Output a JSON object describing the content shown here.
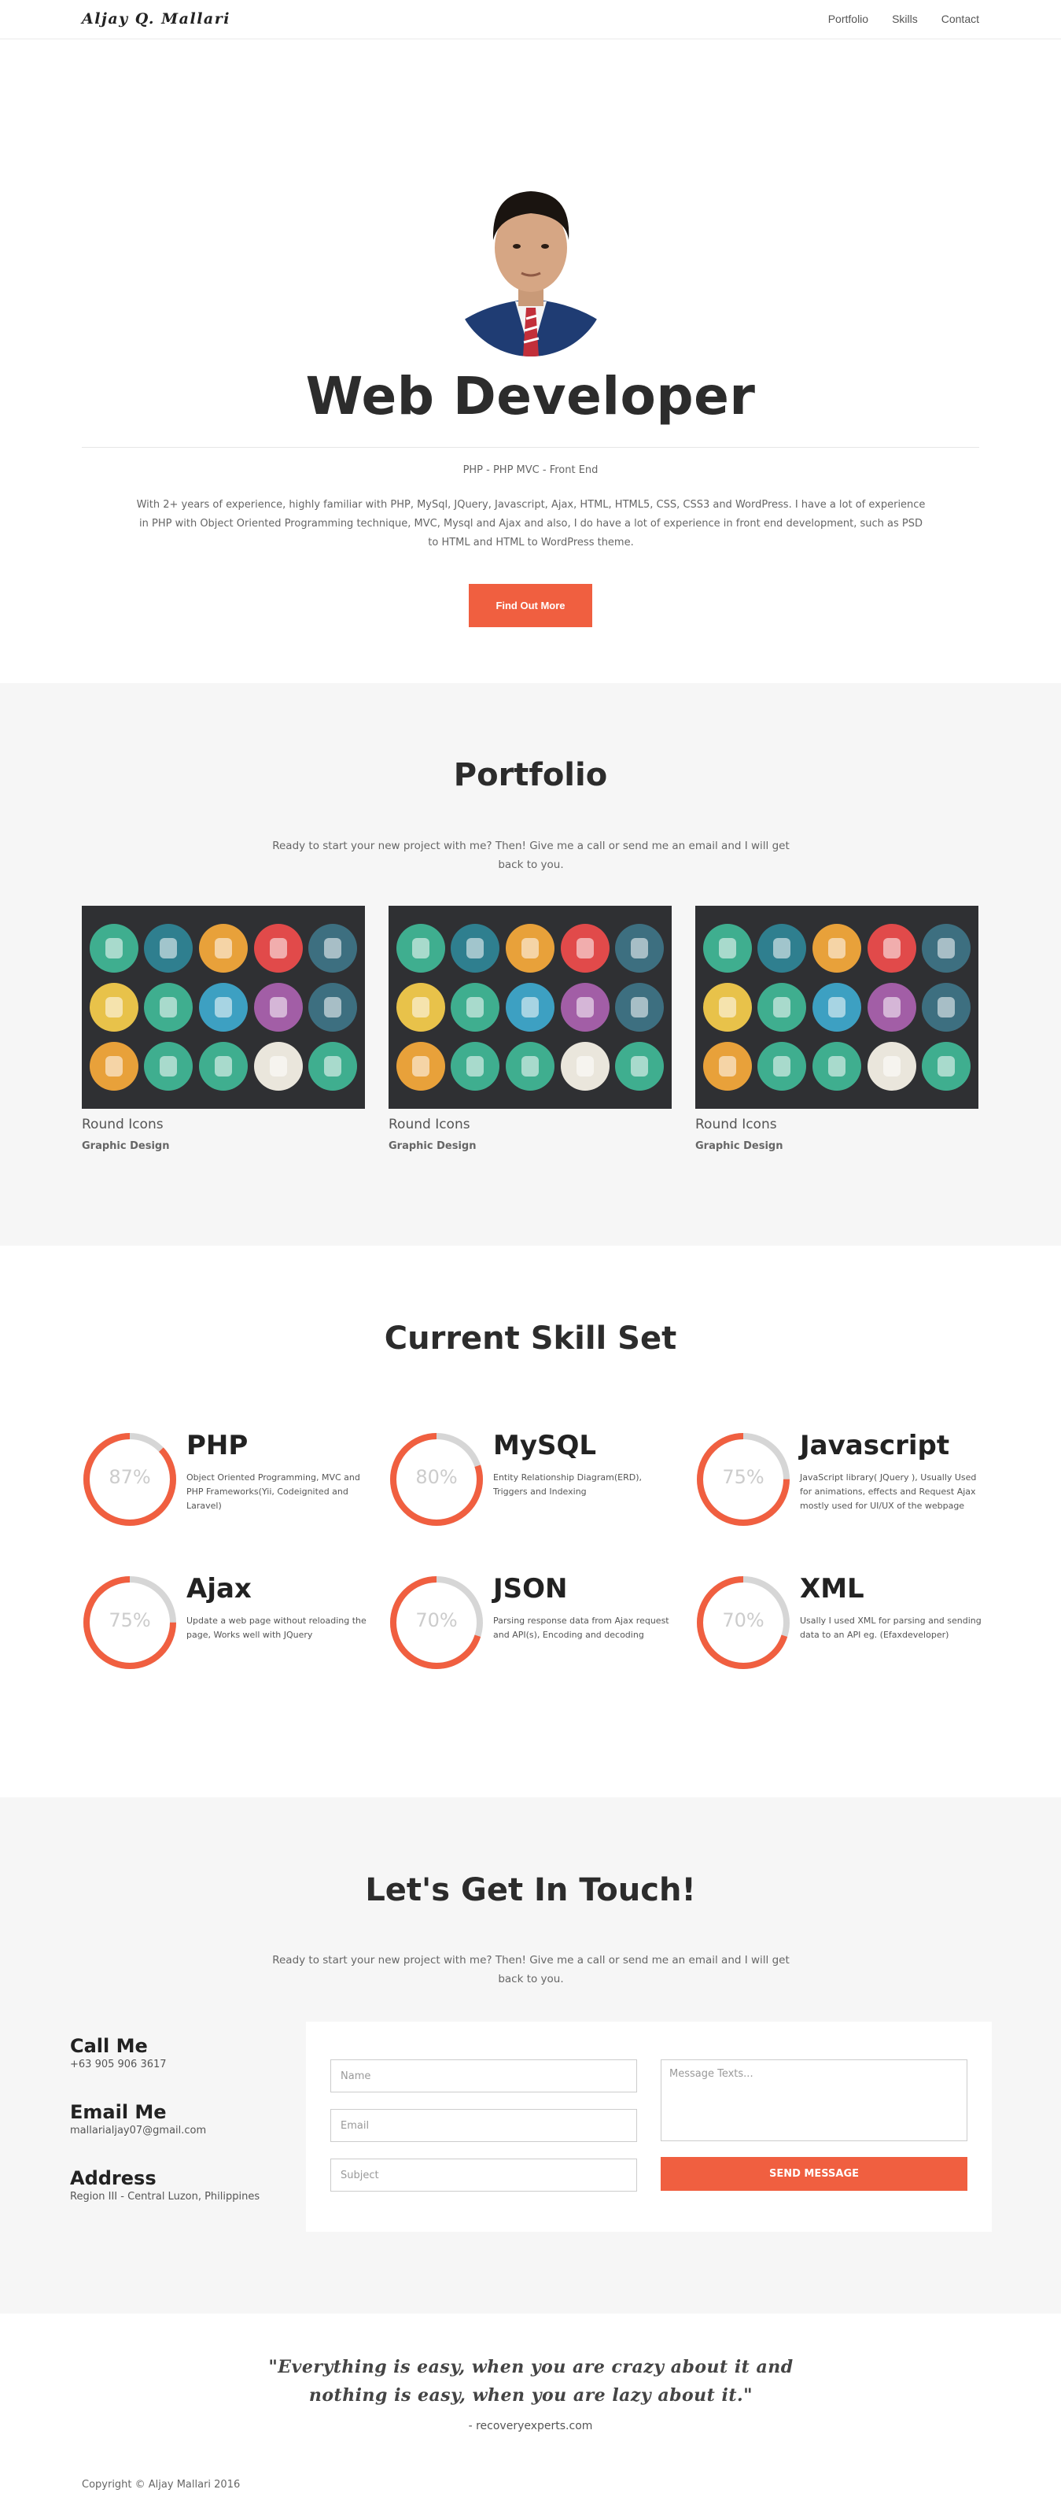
{
  "nav": {
    "brand": "Aljay Q. Mallari",
    "links": [
      "Portfolio",
      "Skills",
      "Contact"
    ]
  },
  "hero": {
    "title": "Web Developer",
    "subtitle": "PHP - PHP MVC - Front End",
    "description": "With 2+ years of experience, highly familiar with PHP, MySql, JQuery, Javascript, Ajax, HTML, HTML5, CSS, CSS3 and WordPress. I have a lot of experience in PHP with Object Oriented Programming technique, MVC, Mysql and Ajax and also, I do have a lot of experience in front end development, such as PSD to HTML and HTML to WordPress theme.",
    "button": "Find Out More"
  },
  "portfolio": {
    "title": "Portfolio",
    "lead": "Ready to start your new project with me? Then! Give me a call or send me an email and I will get back to you.",
    "items": [
      {
        "title": "Round Icons",
        "category": "Graphic Design"
      },
      {
        "title": "Round Icons",
        "category": "Graphic Design"
      },
      {
        "title": "Round Icons",
        "category": "Graphic Design"
      }
    ],
    "icon_colors": [
      "#3fae8f",
      "#2f7f8f",
      "#e8a13a",
      "#e14a4a",
      "#3d6f80",
      "#e8c24a",
      "#3fae8f",
      "#3da0c2",
      "#a25ea6",
      "#3d6f80",
      "#e8a13a",
      "#3fae8f",
      "#3fae8f",
      "#eae6dc",
      "#3fae8f"
    ]
  },
  "skills": {
    "title": "Current Skill Set",
    "accent": "#f05f40",
    "track": "#d6d6d6",
    "items": [
      {
        "name": "PHP",
        "percent": 87,
        "label": "87%",
        "desc": "Object Oriented Programming, MVC and PHP Frameworks(Yii, Codeignited and Laravel)"
      },
      {
        "name": "MySQL",
        "percent": 80,
        "label": "80%",
        "desc": "Entity Relationship Diagram(ERD), Triggers and Indexing"
      },
      {
        "name": "Javascript",
        "percent": 75,
        "label": "75%",
        "desc": "JavaScript library( JQuery ), Usually Used for animations, effects and Request Ajax mostly used for UI/UX of the webpage"
      },
      {
        "name": "Ajax",
        "percent": 75,
        "label": "75%",
        "desc": "Update a web page without reloading the page, Works well with JQuery"
      },
      {
        "name": "JSON",
        "percent": 70,
        "label": "70%",
        "desc": "Parsing response data from Ajax request and API(s), Encoding and decoding"
      },
      {
        "name": "XML",
        "percent": 70,
        "label": "70%",
        "desc": "Usally I used XML for parsing and sending data to an API eg. (Efaxdeveloper)"
      }
    ]
  },
  "contact": {
    "title": "Let's Get In Touch!",
    "lead": "Ready to start your new project with me? Then! Give me a call or send me an email and I will get back to you.",
    "call_label": "Call Me",
    "call_value": "+63 905 906 3617",
    "email_label": "Email Me",
    "email_value": "mallarialjay07@gmail.com",
    "address_label": "Address",
    "address_value": "Region III - Central Luzon, Philippines",
    "form": {
      "name_placeholder": "Name",
      "email_placeholder": "Email",
      "subject_placeholder": "Subject",
      "message_placeholder": "Message Texts...",
      "send_label": "SEND MESSAGE"
    }
  },
  "footer": {
    "quote": "\"Everything is easy, when you are crazy about it and nothing is easy, when you are lazy about it.\"",
    "author": "- recoveryexperts.com",
    "copyright": "Copyright © Aljay Mallari 2016"
  }
}
